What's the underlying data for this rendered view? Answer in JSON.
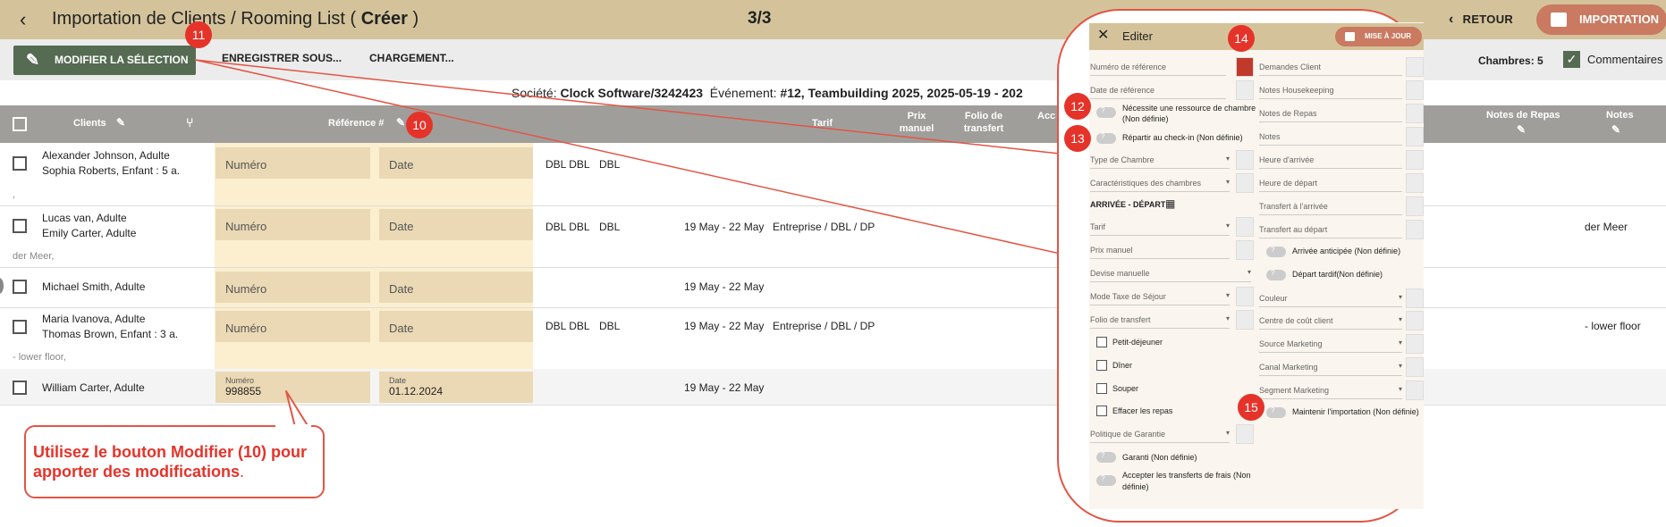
{
  "topbar": {
    "title_prefix": "Importation de Clients / Rooming List ( ",
    "title_bold": "Créer",
    "title_suffix": " )",
    "step": "3/3",
    "back_label": "RETOUR",
    "import_label": "IMPORTATION"
  },
  "toolbar": {
    "modify_selection": "MODIFIER LA SÉLECTION",
    "save_as": "ENREGISTRER SOUS...",
    "load": "CHARGEMENT...",
    "rooms": "Chambres: 5",
    "comments": "Commentaires"
  },
  "context": {
    "societe_label": "Société:",
    "societe_value": "Clock Software/3242423",
    "evenement_label": "Événement:",
    "evenement_value": "#12, Teambuilding 2025, 2025-05-19 - 202"
  },
  "table": {
    "headers": {
      "clients": "Clients",
      "reference": "Référence #",
      "tarif": "Tarif",
      "prix": "Prix\nmanuel",
      "folio": "Folio de\ntransfert",
      "acc": "Acc",
      "notes_repas": "Notes de Repas",
      "notes": "Notes"
    },
    "rows": [
      {
        "clients": [
          "Alexander Johnson, Adulte",
          "Sophia Roberts, Enfant : 5 a."
        ],
        "sub": ",",
        "numero": "Numéro",
        "date": "Date",
        "rooms1": "DBL DBL",
        "rooms2": "DBL",
        "dates": "",
        "tarif": "",
        "notes": ""
      },
      {
        "clients": [
          "Lucas van, Adulte",
          "Emily Carter, Adulte"
        ],
        "sub": "der Meer,",
        "numero": "Numéro",
        "date": "Date",
        "rooms1": "DBL DBL",
        "rooms2": "DBL",
        "dates": "19 May - 22 May",
        "tarif": "Entreprise / DBL / DP",
        "notes": "der Meer"
      },
      {
        "clients": [
          "Michael Smith, Adulte"
        ],
        "sub": "",
        "numero": "Numéro",
        "date": "Date",
        "rooms1": "",
        "rooms2": "",
        "dates": "19 May - 22 May",
        "tarif": "",
        "notes": ""
      },
      {
        "clients": [
          "Maria Ivanova, Adulte",
          "Thomas Brown, Enfant : 3 a."
        ],
        "sub": "- lower floor,",
        "numero": "Numéro",
        "date": "Date",
        "rooms1": "DBL DBL",
        "rooms2": "DBL",
        "dates": "19 May - 22 May",
        "tarif": "Entreprise / DBL / DP",
        "notes": "- lower floor"
      },
      {
        "clients": [
          "William Carter, Adulte"
        ],
        "sub": "",
        "numero_label": "Numéro",
        "numero_value": "998855",
        "date_label": "Date",
        "date_value": "01.12.2024",
        "rooms1": "",
        "rooms2": "",
        "dates": "19 May - 22 May",
        "tarif": "",
        "notes": ""
      }
    ]
  },
  "callout": {
    "text_bold": "Utilisez le bouton Modifier (10) pour apporter des modifications",
    "text_end": "."
  },
  "markers": [
    "10",
    "11",
    "12",
    "13",
    "14",
    "15"
  ],
  "panel": {
    "title": "Editer",
    "update_label": "MISE À JOUR",
    "left": {
      "numero_ref": "Numéro de référence",
      "date_ref": "Date de référence",
      "necessite": "Nécessite une ressource de chambre (Non définie)",
      "repartir": "Répartir au check-in (Non définie)",
      "type_chambre": "Type de Chambre",
      "caracteristiques": "Caractéristiques des chambres",
      "arrivee_depart": "ARRIVÉE - DÉPART",
      "tarif": "Tarif",
      "prix_manuel": "Prix manuel",
      "devise": "Devise manuelle",
      "mode_taxe": "Mode Taxe de Séjour",
      "folio": "Folio de transfert",
      "petit_dej": "Petit-déjeuner",
      "diner": "Dîner",
      "souper": "Souper",
      "effacer": "Effacer les repas",
      "politique": "Politique de Garantie",
      "garanti": "Garanti (Non définie)",
      "accepter": "Accepter les transferts de frais (Non définie)"
    },
    "right": {
      "demandes": "Demandes Client",
      "notes_hk": "Notes Housekeeping",
      "notes_repas": "Notes de Repas",
      "notes": "Notes",
      "heure_arr": "Heure d'arrivée",
      "heure_dep": "Heure de départ",
      "transfert_arr": "Transfert à l'arrivée",
      "transfert_dep": "Transfert au départ",
      "arrivee_ant": "Arrivée anticipée (Non définie)",
      "depart_tard": "Départ tardif(Non définie)",
      "couleur": "Couleur",
      "centre_cout": "Centre de coût client",
      "source_mkt": "Source Marketing",
      "canal_mkt": "Canal Marketing",
      "segment_mkt": "Segment Marketing",
      "maintenir": "Maintenir l'importation (Non définie)"
    }
  },
  "colors": {
    "topbar": "#d4c39a",
    "accent_button": "#c97a60",
    "modify_button": "#556b52",
    "marker": "#e5332a",
    "reference_column": "#fcefcf"
  }
}
